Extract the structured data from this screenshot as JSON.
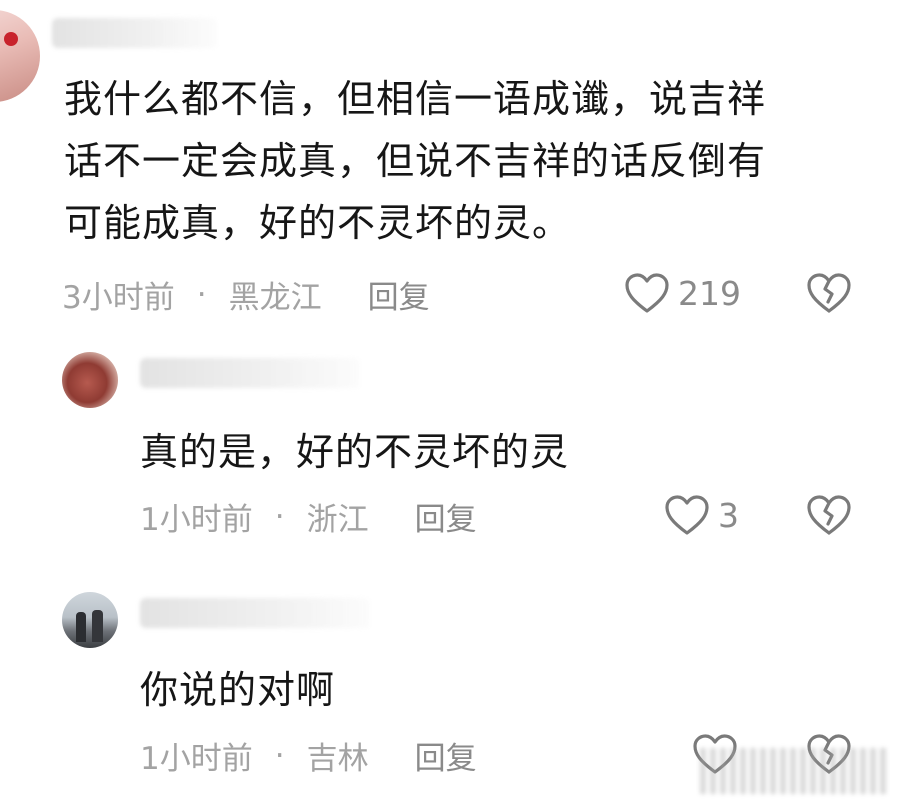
{
  "comments": [
    {
      "text_lines": [
        "我什么都不信，但相信一语成谶，说吉祥",
        "话不一定会成真，但说不吉祥的话反倒有",
        "可能成真，好的不灵坏的灵。"
      ],
      "time": "3小时前",
      "location": "黑龙江",
      "reply_label": "回复",
      "like_count": "219"
    },
    {
      "text": "真的是，好的不灵坏的灵",
      "time": "1小时前",
      "location": "浙江",
      "reply_label": "回复",
      "like_count": "3"
    },
    {
      "text": "你说的对啊",
      "time": "1小时前",
      "location": "吉林",
      "reply_label": "回复"
    }
  ],
  "meta_separator": "·",
  "colors": {
    "text": "#161616",
    "meta": "#a3a3a3",
    "icon": "#7a7a7a"
  }
}
